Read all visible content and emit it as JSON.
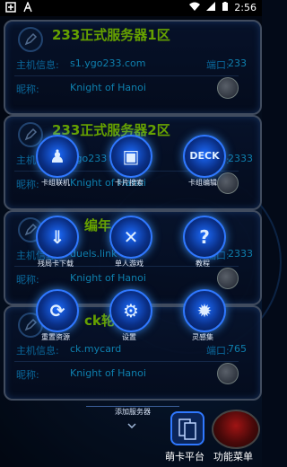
{
  "status_bar": {
    "left_icons": [
      "kaka-logo-icon",
      "notification-a-icon"
    ],
    "time": "2:56",
    "right_icons": [
      "wifi-icon",
      "signal-icon",
      "battery-icon"
    ]
  },
  "servers": [
    {
      "title": "233正式服务器1区",
      "host_label": "主机信息:",
      "host": "s1.ygo233.com",
      "port_label": "端口:",
      "port": "233",
      "nick_label": "昵称:",
      "nick": "Knight of Hanoi"
    },
    {
      "title": "233正式服务器2区",
      "host_label": "主机信息:",
      "host": "ygo233",
      "port_label": "端口:",
      "port": "2333",
      "nick_label": "昵称:",
      "nick": "Knight of Hanoi"
    },
    {
      "title": "编年",
      "host_label": "主机信息:",
      "host": "duels.link",
      "port_label": "端口:",
      "port": "2333",
      "nick_label": "昵称:",
      "nick": "Knight of Hanoi"
    },
    {
      "title": "ck轮",
      "host_label": "主机信息:",
      "host": "ck.mycard",
      "port_label": "端口:",
      "port": "765",
      "nick_label": "昵称:",
      "nick": "Knight of Hanoi"
    }
  ],
  "menu": [
    {
      "label": "卡组联机",
      "icon": "duel-icon"
    },
    {
      "label": "卡片搜索",
      "icon": "card-search-icon"
    },
    {
      "label": "卡组编辑",
      "icon": "deck-edit-icon"
    },
    {
      "label": "残局卡下载",
      "icon": "puzzle-download-icon"
    },
    {
      "label": "单人游戏",
      "icon": "single-player-icon"
    },
    {
      "label": "教程",
      "icon": "help-icon"
    },
    {
      "label": "重置资源",
      "icon": "reset-icon"
    },
    {
      "label": "设置",
      "icon": "settings-icon"
    },
    {
      "label": "灵感集",
      "icon": "idea-icon"
    }
  ],
  "add_server_label": "添加服务器",
  "bottom": {
    "left_label": "萌卡平台",
    "right_label": "功能菜单"
  },
  "colors": {
    "accent": "#8ee000",
    "text_blue": "#14b0f0",
    "glow": "#2f78ff"
  }
}
